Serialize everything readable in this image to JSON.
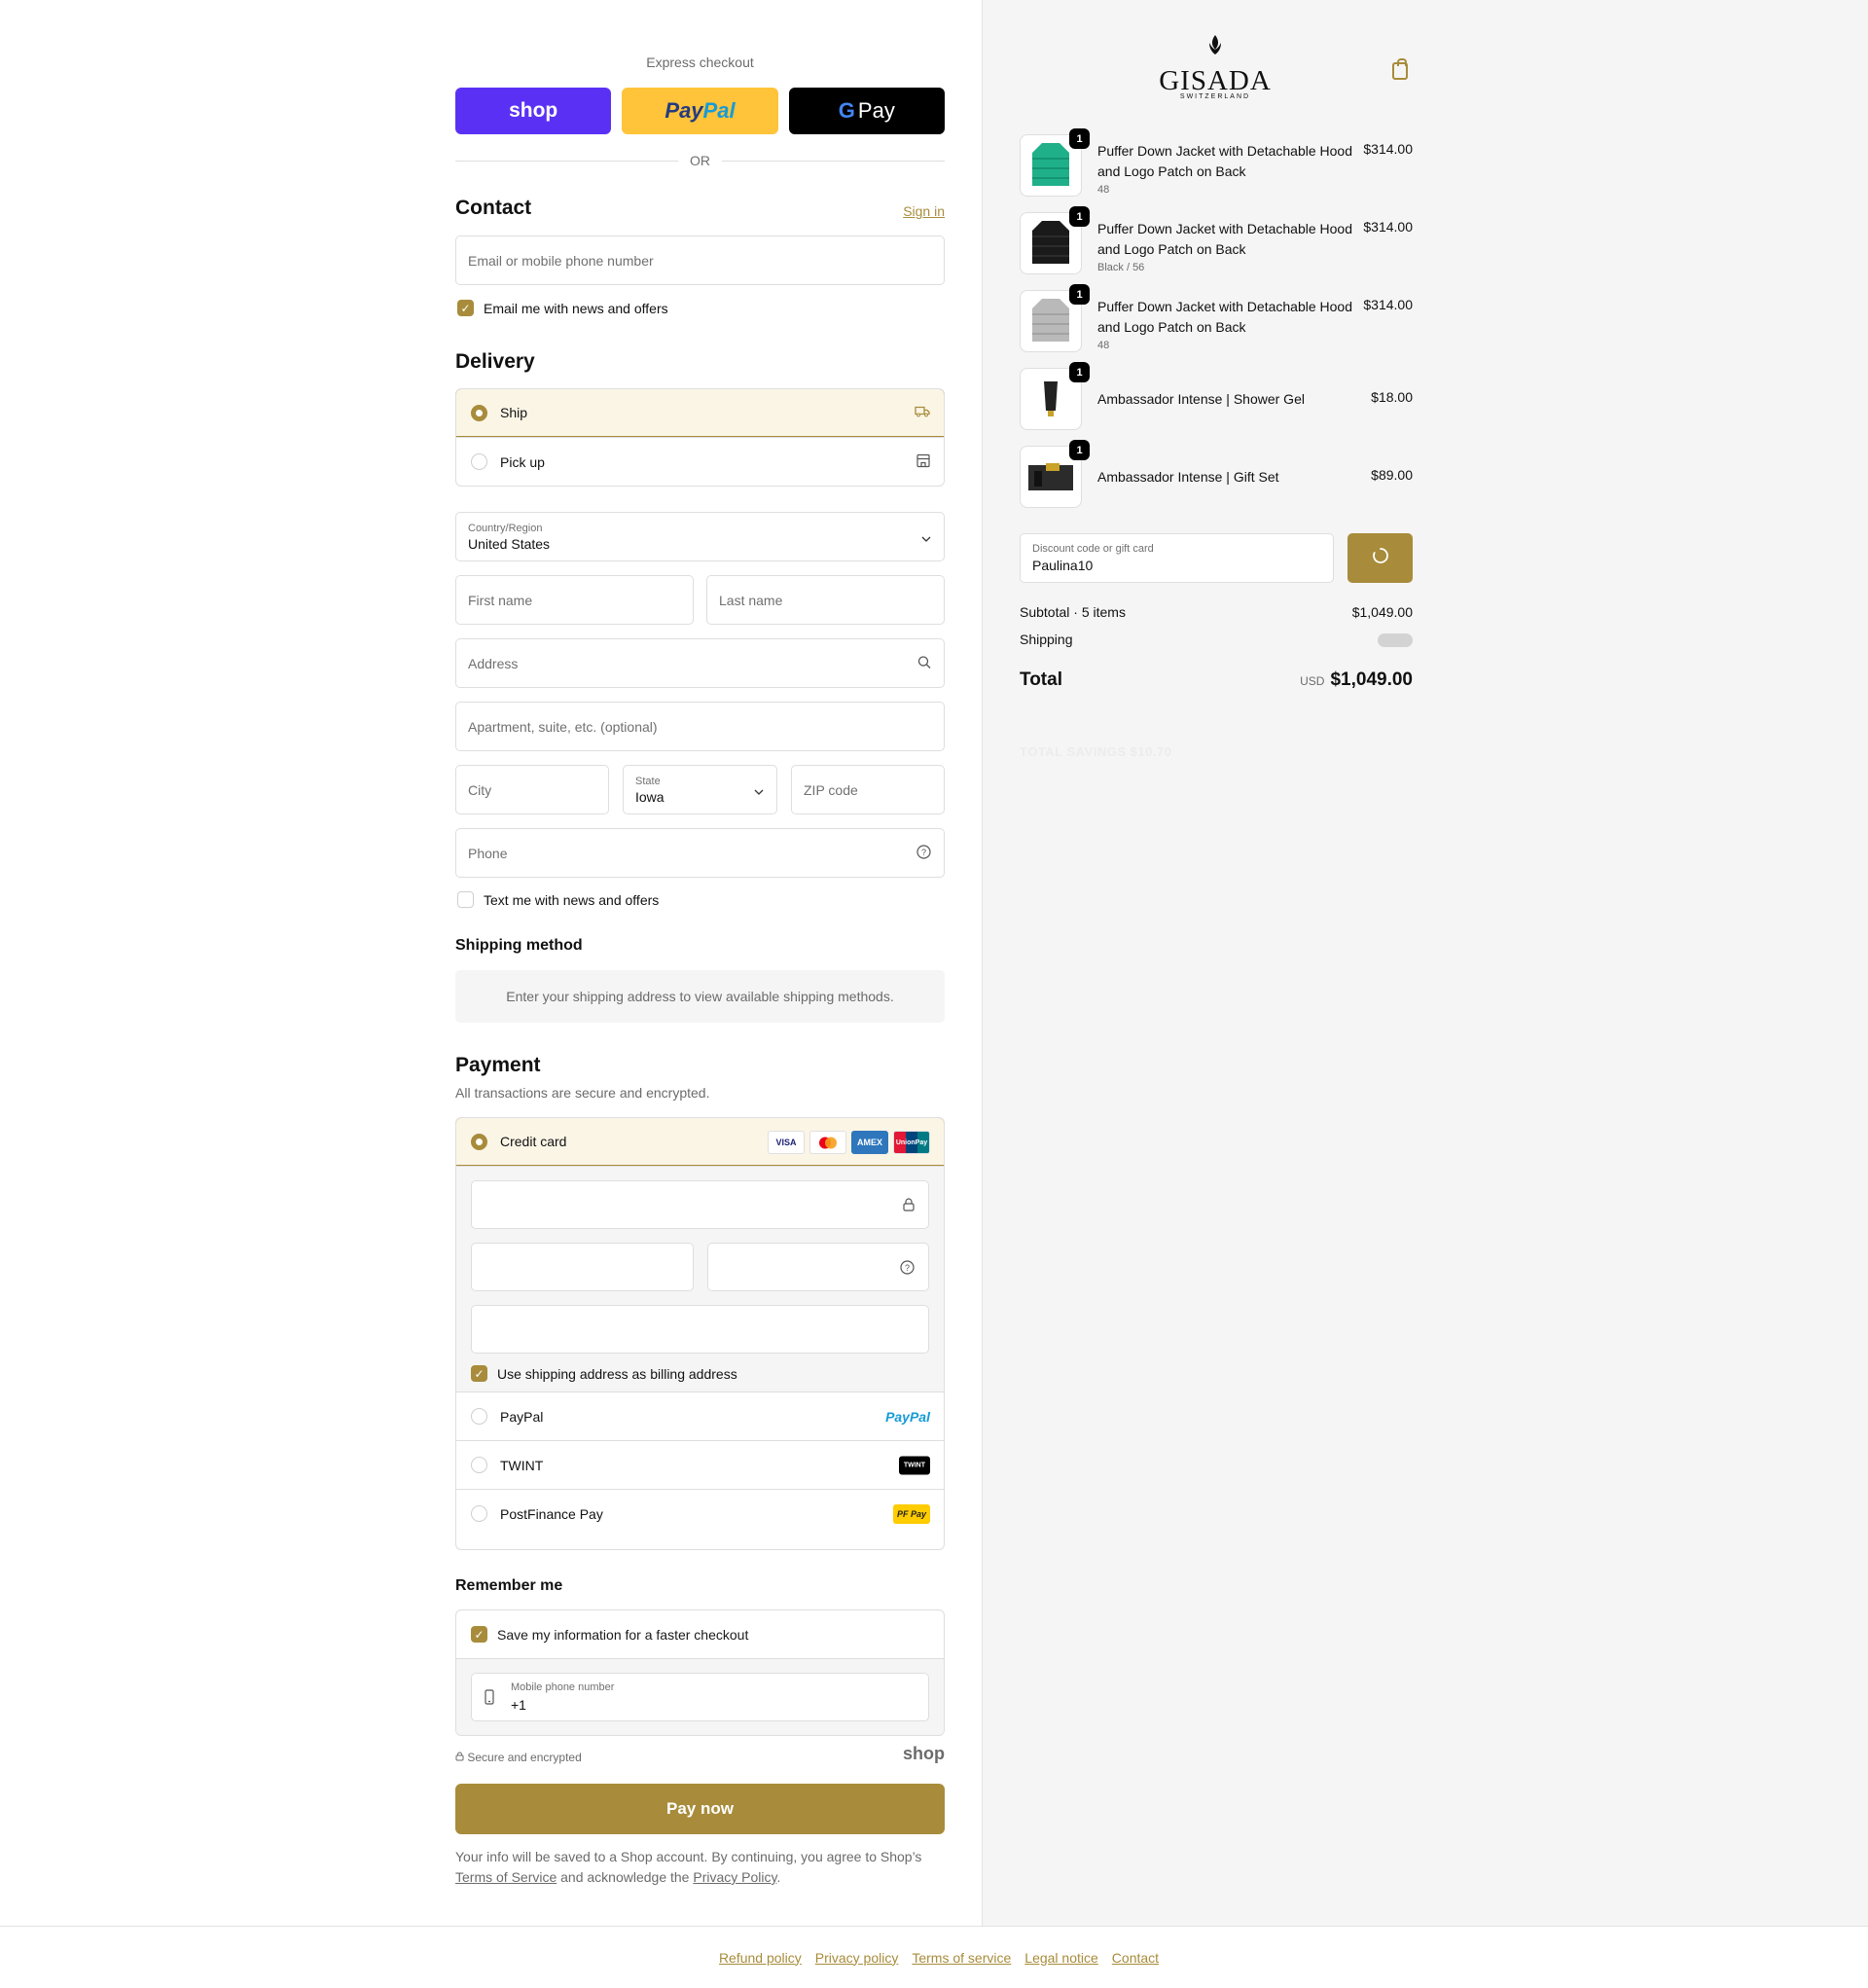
{
  "express": {
    "label": "Express checkout",
    "shop_label": "shop",
    "paypal_label_a": "Pay",
    "paypal_label_b": "Pal",
    "gpay_g": "G",
    "gpay_label": "Pay"
  },
  "or_label": "OR",
  "contact": {
    "heading": "Contact",
    "sign_in": "Sign in",
    "email_placeholder": "Email or mobile phone number",
    "news_label": "Email me with news and offers",
    "news_checked": true
  },
  "delivery": {
    "heading": "Delivery",
    "options": [
      {
        "label": "Ship",
        "selected": true,
        "icon": "truck-icon"
      },
      {
        "label": "Pick up",
        "selected": false,
        "icon": "store-icon"
      }
    ],
    "country_label": "Country/Region",
    "country_value": "United States",
    "first_name": "First name",
    "last_name": "Last name",
    "address": "Address",
    "apartment": "Apartment, suite, etc. (optional)",
    "city": "City",
    "state_label": "State",
    "state_value": "Iowa",
    "zip": "ZIP code",
    "phone": "Phone",
    "text_label": "Text me with news and offers"
  },
  "shipping_method": {
    "heading": "Shipping method",
    "info": "Enter your shipping address to view available shipping methods."
  },
  "payment": {
    "heading": "Payment",
    "subtitle": "All transactions are secure and encrypted.",
    "credit_card": "Credit card",
    "card_brands": [
      "VISA",
      "MC",
      "AMEX",
      "UnionPay"
    ],
    "billing_label": "Use shipping address as billing address",
    "paypal": "PayPal",
    "paypal_logo": "PayPal",
    "twint": "TWINT",
    "twint_logo": "TWINT",
    "postfinance": "PostFinance Pay",
    "postfinance_logo": "PF Pay"
  },
  "remember": {
    "heading": "Remember me",
    "save_label": "Save my information for a faster checkout",
    "mobile_label": "Mobile phone number",
    "mobile_value": "+1",
    "secure": "Secure and encrypted",
    "shop_mark": "shop"
  },
  "pay_now": "Pay now",
  "legal": {
    "text1": "Your info will be saved to a Shop account. By continuing, you agree to Shop’s",
    "terms": "Terms of Service",
    "text2": "and acknowledge the",
    "privacy": "Privacy Policy",
    "text3": "."
  },
  "brand": {
    "name": "GISADA",
    "sub": "SWITZERLAND",
    "accent": "#a88c3b"
  },
  "cart": {
    "items": [
      {
        "name": "Puffer Down Jacket with Detachable Hood and Logo Patch on Back",
        "variant": "48",
        "price": "$314.00",
        "qty": "1",
        "color": "#1fb08a"
      },
      {
        "name": "Puffer Down Jacket with Detachable Hood and Logo Patch on Back",
        "variant": "Black / 56",
        "price": "$314.00",
        "qty": "1",
        "color": "#1a1a1a"
      },
      {
        "name": "Puffer Down Jacket with Detachable Hood and Logo Patch on Back",
        "variant": "48",
        "price": "$314.00",
        "qty": "1",
        "color": "#b9b9b9"
      },
      {
        "name": "Ambassador Intense | Shower Gel",
        "variant": "",
        "price": "$18.00",
        "qty": "1",
        "color": "#222222"
      },
      {
        "name": "Ambassador Intense | Gift Set",
        "variant": "",
        "price": "$89.00",
        "qty": "1",
        "color": "#2b2b2b"
      }
    ],
    "discount_label": "Discount code or gift card",
    "discount_value": "Paulina10",
    "subtotal_label": "Subtotal · 5 items",
    "subtotal_value": "$1,049.00",
    "shipping_label": "Shipping",
    "total_label": "Total",
    "currency": "USD",
    "total_value": "$1,049.00",
    "savings": "TOTAL SAVINGS $10.70"
  },
  "footer": [
    "Refund policy",
    "Privacy policy",
    "Terms of service",
    "Legal notice",
    "Contact"
  ]
}
